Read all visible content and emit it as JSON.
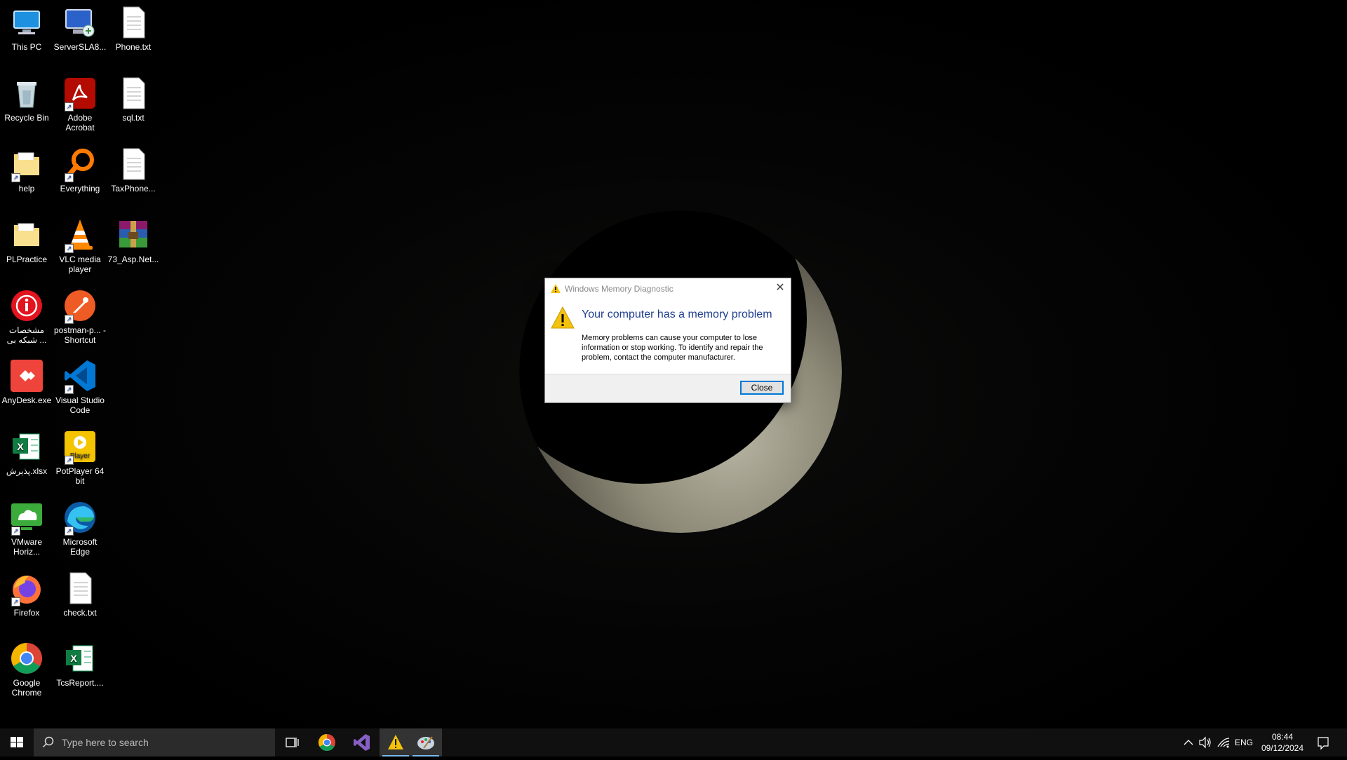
{
  "desktop_icons": [
    {
      "label": "This PC",
      "icon": "this-pc-icon"
    },
    {
      "label": "ServerSLA8...",
      "icon": "remote-desktop-icon"
    },
    {
      "label": "Phone.txt",
      "icon": "text-file-icon"
    },
    {
      "label": "Recycle Bin",
      "icon": "recycle-bin-icon"
    },
    {
      "label": "Adobe Acrobat",
      "icon": "adobe-acrobat-icon"
    },
    {
      "label": "sql.txt",
      "icon": "text-file-icon"
    },
    {
      "label": "help",
      "icon": "folder-icon"
    },
    {
      "label": "Everything",
      "icon": "everything-search-icon"
    },
    {
      "label": "TaxPhone...",
      "icon": "text-file-icon"
    },
    {
      "label": "PLPractice",
      "icon": "folder-icon"
    },
    {
      "label": "VLC media player",
      "icon": "vlc-icon"
    },
    {
      "label": "73_Asp.Net...",
      "icon": "winrar-icon"
    },
    {
      "label": "مشخصات شبکه بی ...",
      "icon": "info-icon"
    },
    {
      "label": "postman-p... - Shortcut",
      "icon": "postman-icon"
    },
    {
      "label": "AnyDesk.exe",
      "icon": "anydesk-icon"
    },
    {
      "label": "Visual Studio Code",
      "icon": "vscode-icon"
    },
    {
      "label": "پذیرش.xlsx",
      "icon": "excel-icon"
    },
    {
      "label": "PotPlayer 64 bit",
      "icon": "potplayer-icon"
    },
    {
      "label": "VMware Horiz...",
      "icon": "vmware-horizon-icon"
    },
    {
      "label": "Microsoft Edge",
      "icon": "edge-icon"
    },
    {
      "label": "Firefox",
      "icon": "firefox-icon"
    },
    {
      "label": "check.txt",
      "icon": "text-file-icon"
    },
    {
      "label": "Google Chrome",
      "icon": "chrome-icon"
    },
    {
      "label": "TcsReport....",
      "icon": "excel-icon"
    }
  ],
  "dialog": {
    "title": "Windows Memory Diagnostic",
    "heading": "Your computer has a memory problem",
    "body": "Memory problems can cause your computer to lose information or stop working. To identify and repair the problem, contact the computer manufacturer.",
    "close_label": "Close"
  },
  "taskbar": {
    "search_placeholder": "Type here to search",
    "pinned": [
      "task-view-icon",
      "chrome-icon",
      "visual-studio-icon",
      "warning-icon",
      "paint-icon"
    ],
    "language": "ENG",
    "time": "08:44",
    "date": "09/12/2024"
  },
  "colors": {
    "dialog_heading": "#1f3f8f",
    "taskbar": "#101010",
    "accent": "#0078d7"
  }
}
